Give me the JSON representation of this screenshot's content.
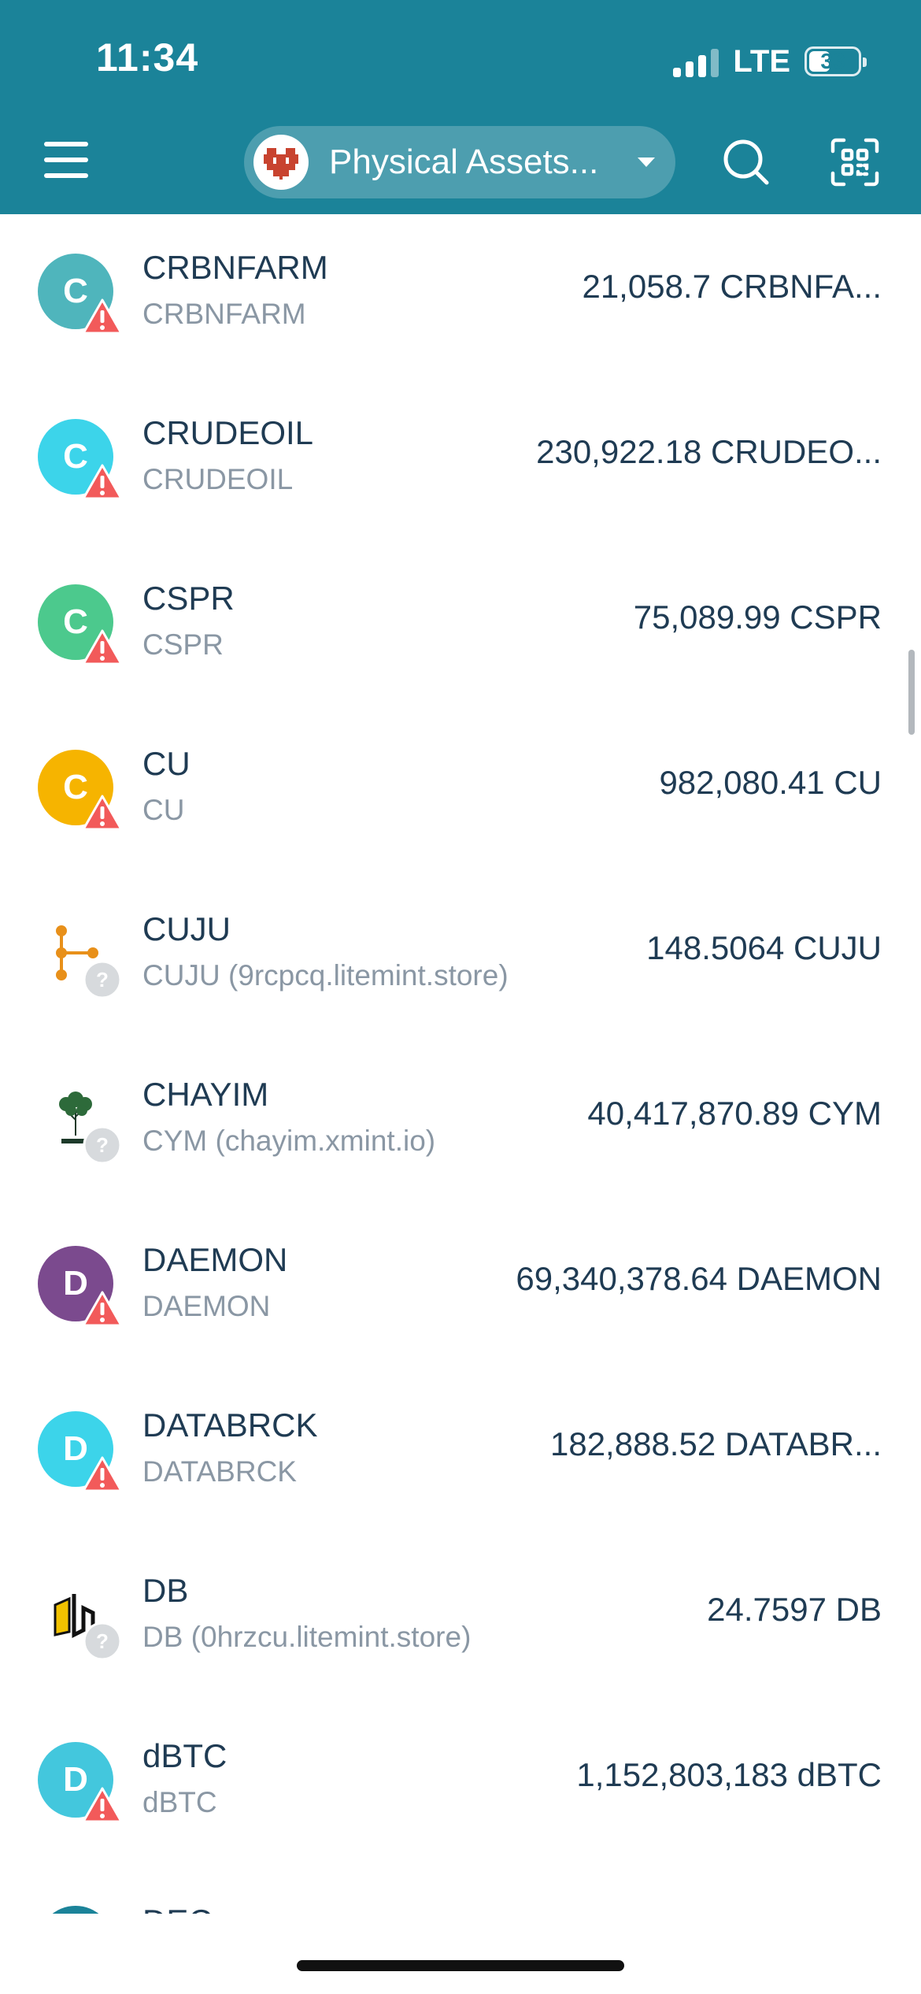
{
  "status_bar": {
    "time": "11:34",
    "network": "LTE",
    "battery": "33"
  },
  "header": {
    "wallet_name": "Physical Assets..."
  },
  "tokens": [
    {
      "name": "CRBNFARM",
      "subtitle": "CRBNFARM",
      "amount": "21,058.7 CRBNFA...",
      "letter": "C",
      "color": "#4fb5bc",
      "badge": "warning"
    },
    {
      "name": "CRUDEOIL",
      "subtitle": "CRUDEOIL",
      "amount": "230,922.18 CRUDEO...",
      "letter": "C",
      "color": "#3cd4ea",
      "badge": "warning"
    },
    {
      "name": "CSPR",
      "subtitle": "CSPR",
      "amount": "75,089.99 CSPR",
      "letter": "C",
      "color": "#4cc98d",
      "badge": "warning"
    },
    {
      "name": "CU",
      "subtitle": "CU",
      "amount": "982,080.41 CU",
      "letter": "C",
      "color": "#f6b400",
      "badge": "warning"
    },
    {
      "name": "CUJU",
      "subtitle": "CUJU (9rcpcq.litemint.store)",
      "amount": "148.5064 CUJU",
      "logo": "cuju-logo",
      "badge": "unknown"
    },
    {
      "name": "CHAYIM",
      "subtitle": "CYM (chayim.xmint.io)",
      "amount": "40,417,870.89 CYM",
      "logo": "chayim-tree-logo",
      "badge": "unknown"
    },
    {
      "name": "DAEMON",
      "subtitle": "DAEMON",
      "amount": "69,340,378.64 DAEMON",
      "letter": "D",
      "color": "#7b4a8e",
      "badge": "warning"
    },
    {
      "name": "DATABRCK",
      "subtitle": "DATABRCK",
      "amount": "182,888.52 DATABR...",
      "letter": "D",
      "color": "#3cd4ea",
      "badge": "warning"
    },
    {
      "name": "DB",
      "subtitle": "DB (0hrzcu.litemint.store)",
      "amount": "24.7597 DB",
      "logo": "db-logo",
      "badge": "unknown"
    },
    {
      "name": "dBTC",
      "subtitle": "dBTC",
      "amount": "1,152,803,183 dBTC",
      "letter": "D",
      "color": "#43c7dd",
      "badge": "warning"
    }
  ],
  "partial_next_row": {
    "name": "DEC",
    "color": "#1b8399"
  }
}
